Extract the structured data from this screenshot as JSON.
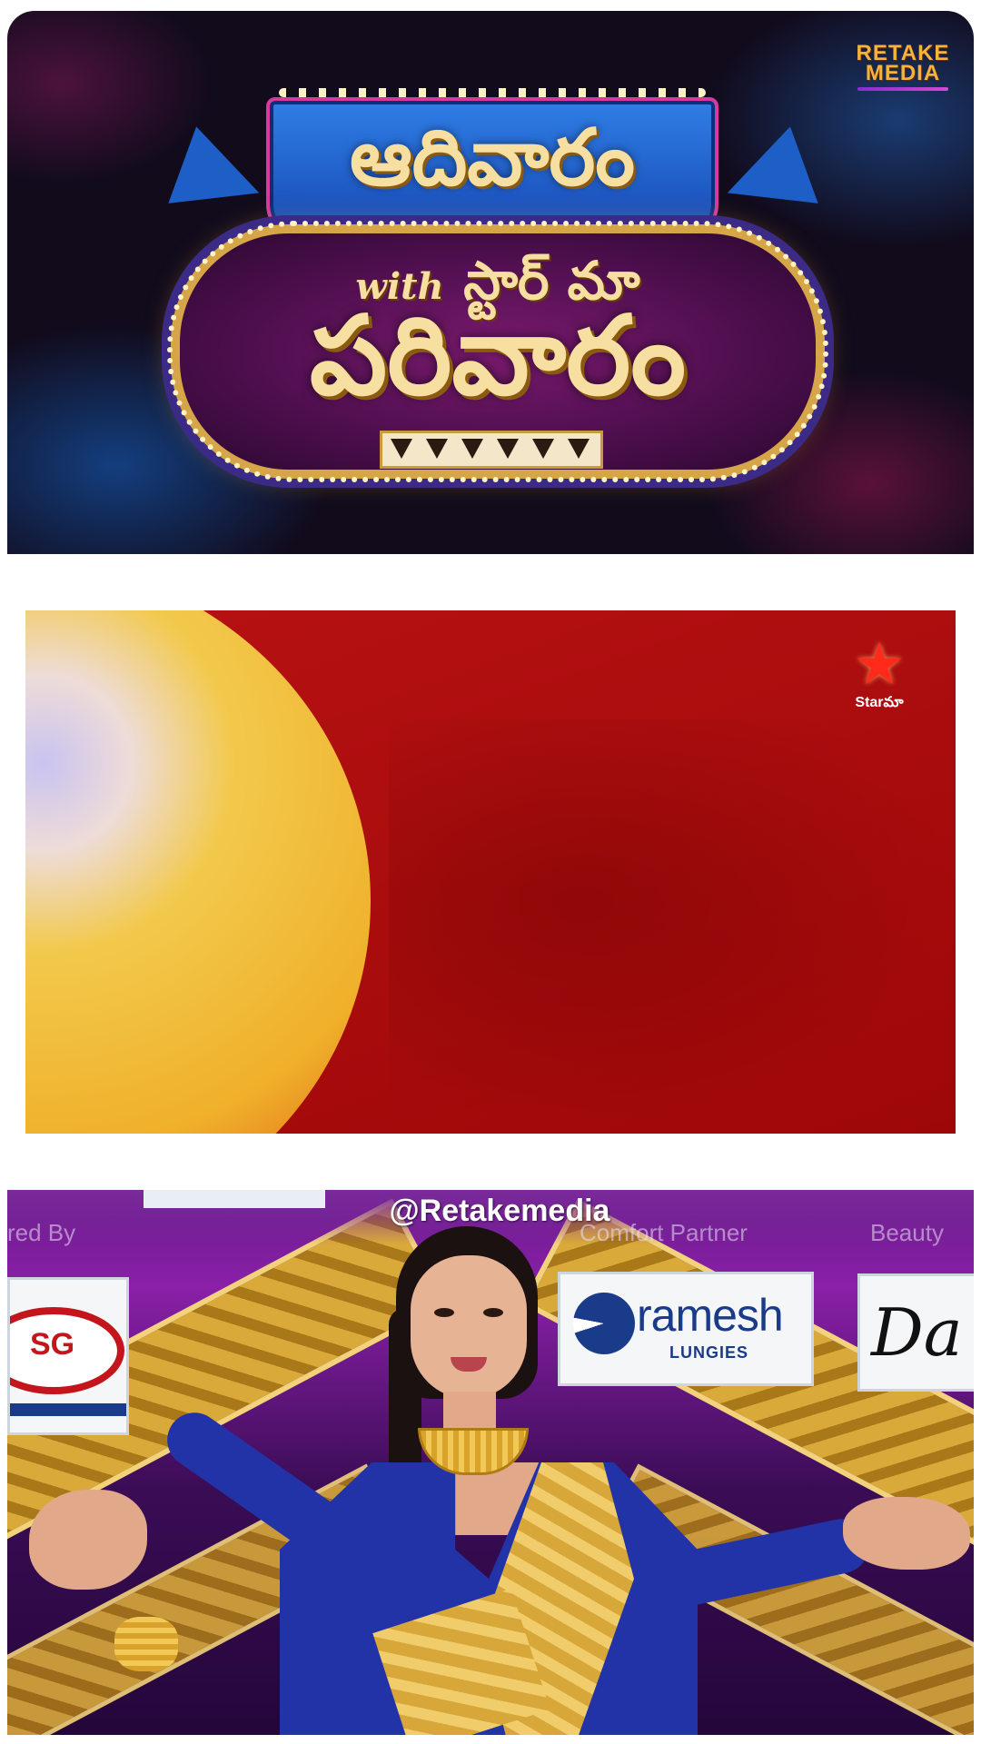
{
  "panels": {
    "title_card": {
      "channel_logo": {
        "line1": "RETAKE",
        "line2": "MEDIA"
      },
      "show_title_top": "ఆదివారం",
      "show_title_with": "with",
      "show_title_channel": "స్టార్ మా",
      "show_title_main": "పరివారం"
    },
    "red_frame": {
      "broadcaster_logo_text": "Starమా"
    },
    "stage": {
      "watermark": "@Retakemedia",
      "sponsor_captions": {
        "left": "red By",
        "middle": "Comfort Partner",
        "right": "Beauty"
      },
      "sponsors": {
        "left_logo_text": "SG",
        "middle_logo_name": "ramesh",
        "middle_logo_sub": "LUNGIES",
        "right_logo_text": "Da"
      }
    }
  },
  "colors": {
    "retake_gold": "#f4b33b",
    "title_gold": "#f6dfa0",
    "red_frame": "#b40809",
    "saree_blue": "#2233a8",
    "stage_purple": "#6a1a8c"
  },
  "icons": {
    "broadcaster": "star-icon"
  }
}
